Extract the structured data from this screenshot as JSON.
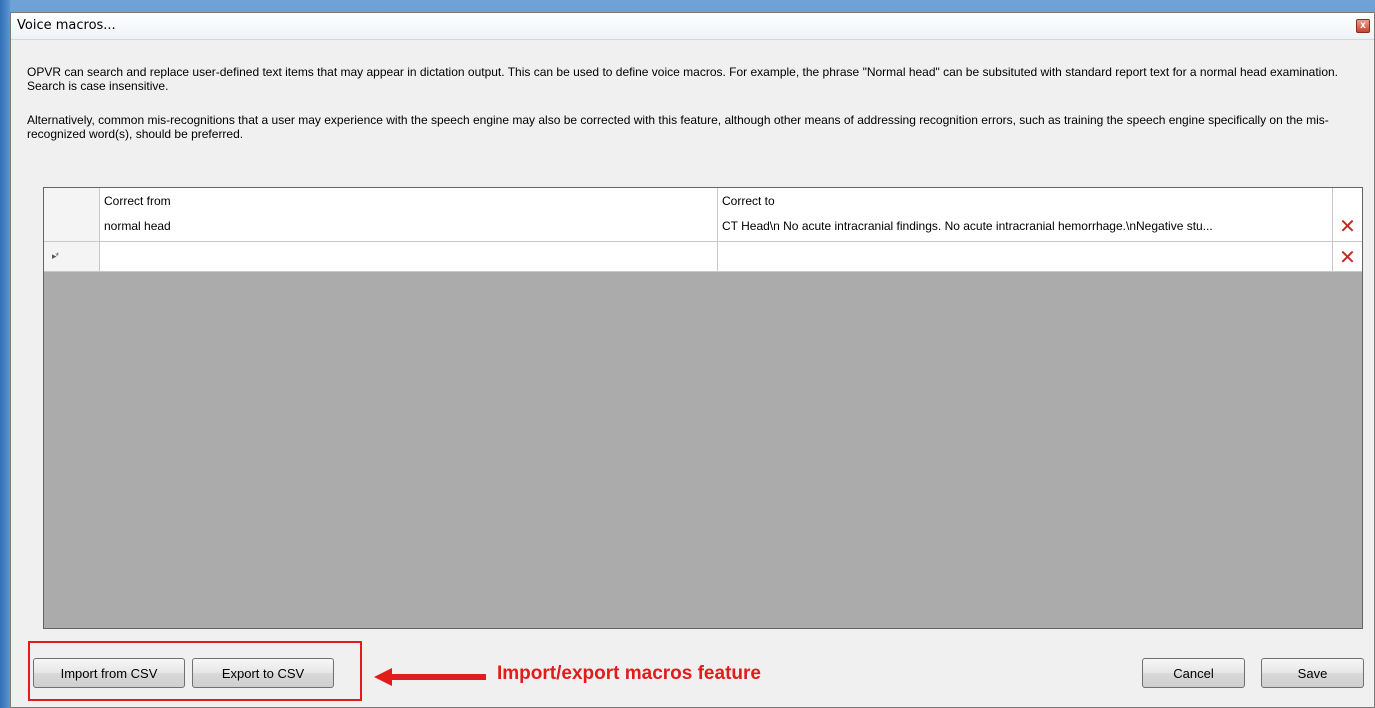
{
  "window": {
    "title": "Voice macros...",
    "close_glyph": "x"
  },
  "description": {
    "paragraph1": "OPVR can search and replace user-defined text items that may appear in dictation output. This can be used to define voice macros. For example, the phrase \"Normal head\" can be subsituted with standard report text for a normal head examination. Search is case insensitive.",
    "paragraph2": "Alternatively, common mis-recognitions that a user may experience with the speech engine may also be corrected with this feature, although other means of addressing recognition errors, such as training the speech engine specifically on the mis-recognized word(s), should be preferred."
  },
  "grid": {
    "columns": [
      "Correct from",
      "Correct to"
    ],
    "rows": [
      {
        "indicator": "",
        "from": "normal head",
        "to": "CT Head\\n No acute intracranial findings. No acute intracranial hemorrhage.\\nNegative stu...",
        "delete_icon": "delete-x-icon"
      },
      {
        "indicator": "▸*",
        "from": "",
        "to": "",
        "delete_icon": "delete-x-icon"
      }
    ],
    "delete_glyph": "✕"
  },
  "buttons": {
    "import": "Import from CSV",
    "export": "Export to CSV",
    "cancel": "Cancel",
    "save": "Save"
  },
  "annotation": {
    "text": "Import/export macros feature",
    "color": "#e21b1b"
  }
}
